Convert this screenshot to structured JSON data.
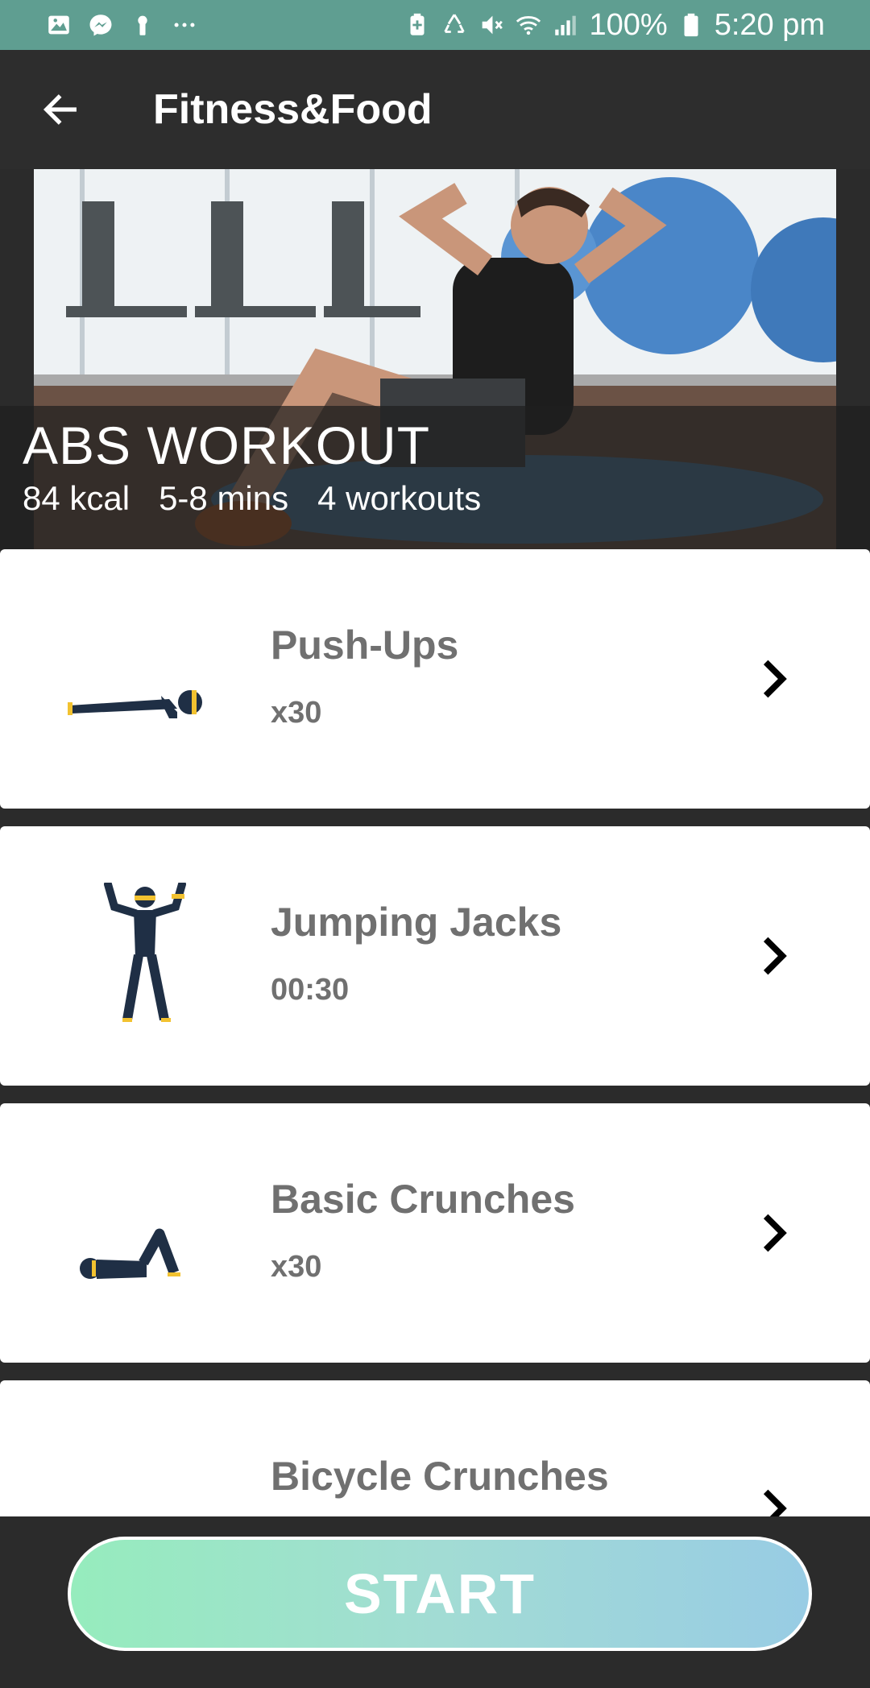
{
  "status_bar": {
    "battery_percent": "100%",
    "time": "5:20 pm",
    "left_icons": [
      "image-icon",
      "messenger-icon",
      "keyhole-icon",
      "more-dots-icon"
    ],
    "right_icons": [
      "battery-saver-icon",
      "recycle-icon",
      "mute-icon",
      "wifi-icon",
      "signal-icon",
      "battery-icon"
    ]
  },
  "app_bar": {
    "title": "Fitness&Food",
    "back_icon": "arrow-back-icon"
  },
  "hero": {
    "title": "ABS WORKOUT",
    "kcal": "84 kcal",
    "duration": "5-8 mins",
    "workouts": "4 workouts"
  },
  "exercises": [
    {
      "name": "Push-Ups",
      "detail": "x30",
      "icon": "push-up-figure-icon"
    },
    {
      "name": "Jumping Jacks",
      "detail": "00:30",
      "icon": "jumping-jack-figure-icon"
    },
    {
      "name": "Basic Crunches",
      "detail": "x30",
      "icon": "crunch-figure-icon"
    },
    {
      "name": "Bicycle Crunches",
      "detail": "",
      "icon": "bicycle-crunch-figure-icon"
    }
  ],
  "actions": {
    "start_label": "START"
  },
  "colors": {
    "status_bar": "#5f9e91",
    "app_bar": "#2d2d2d",
    "figure": "#1f2f45",
    "figure_accent": "#f2c230",
    "start_gradient_left": "#96ecbd",
    "start_gradient_right": "#98cce4",
    "exercise_text": "#707070"
  }
}
